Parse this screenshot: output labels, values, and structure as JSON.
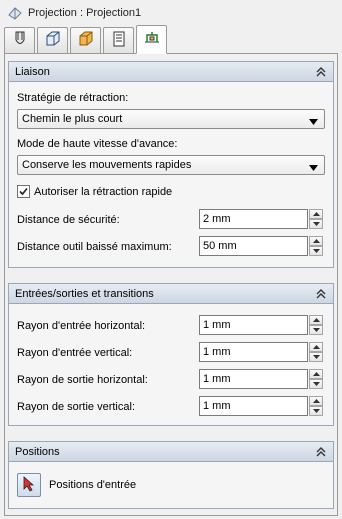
{
  "window": {
    "title": "Projection : Projection1"
  },
  "tabs": [
    {
      "icon": "tool-icon",
      "active": false
    },
    {
      "icon": "stock-box-icon",
      "active": false
    },
    {
      "icon": "geometry-box-icon",
      "active": false
    },
    {
      "icon": "passes-icon",
      "active": false
    },
    {
      "icon": "linking-icon",
      "active": true
    }
  ],
  "liaison": {
    "header": "Liaison",
    "retract_label": "Stratégie de rétraction:",
    "retract_value": "Chemin le plus court",
    "feed_label": "Mode de haute vitesse d'avance:",
    "feed_value": "Conserve les mouvements rapides",
    "quick_retract_label": "Autoriser la rétraction rapide",
    "quick_retract_checked": true,
    "safe_label": "Distance de sécurité:",
    "safe_value": "2 mm",
    "lowered_label": "Distance outil baissé maximum:",
    "lowered_value": "50 mm"
  },
  "transitions": {
    "header": "Entrées/sorties et transitions",
    "rows": [
      {
        "label": "Rayon d'entrée horizontal:",
        "value": "1 mm"
      },
      {
        "label": "Rayon d'entrée vertical:",
        "value": "1 mm"
      },
      {
        "label": "Rayon de sortie horizontal:",
        "value": "1 mm"
      },
      {
        "label": "Rayon de sortie vertical:",
        "value": "1 mm"
      }
    ]
  },
  "positions": {
    "header": "Positions",
    "entry_label": "Positions d'entrée"
  }
}
